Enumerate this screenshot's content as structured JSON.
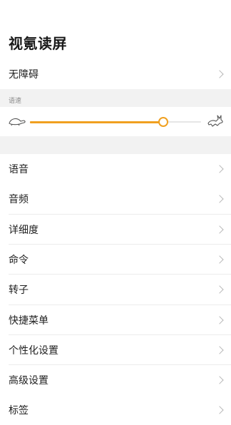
{
  "page": {
    "title": "视氪读屏"
  },
  "accessibility_row": {
    "label": "无障碍"
  },
  "speed": {
    "section_label": "语速",
    "value_fraction": 0.78,
    "accent_color": "#f0a020"
  },
  "menu": {
    "items": [
      {
        "label": "语音"
      },
      {
        "label": "音频"
      },
      {
        "label": "详细度"
      },
      {
        "label": "命令"
      },
      {
        "label": "转子"
      },
      {
        "label": "快捷菜单"
      },
      {
        "label": "个性化设置"
      },
      {
        "label": "高级设置"
      },
      {
        "label": "标签"
      }
    ]
  }
}
